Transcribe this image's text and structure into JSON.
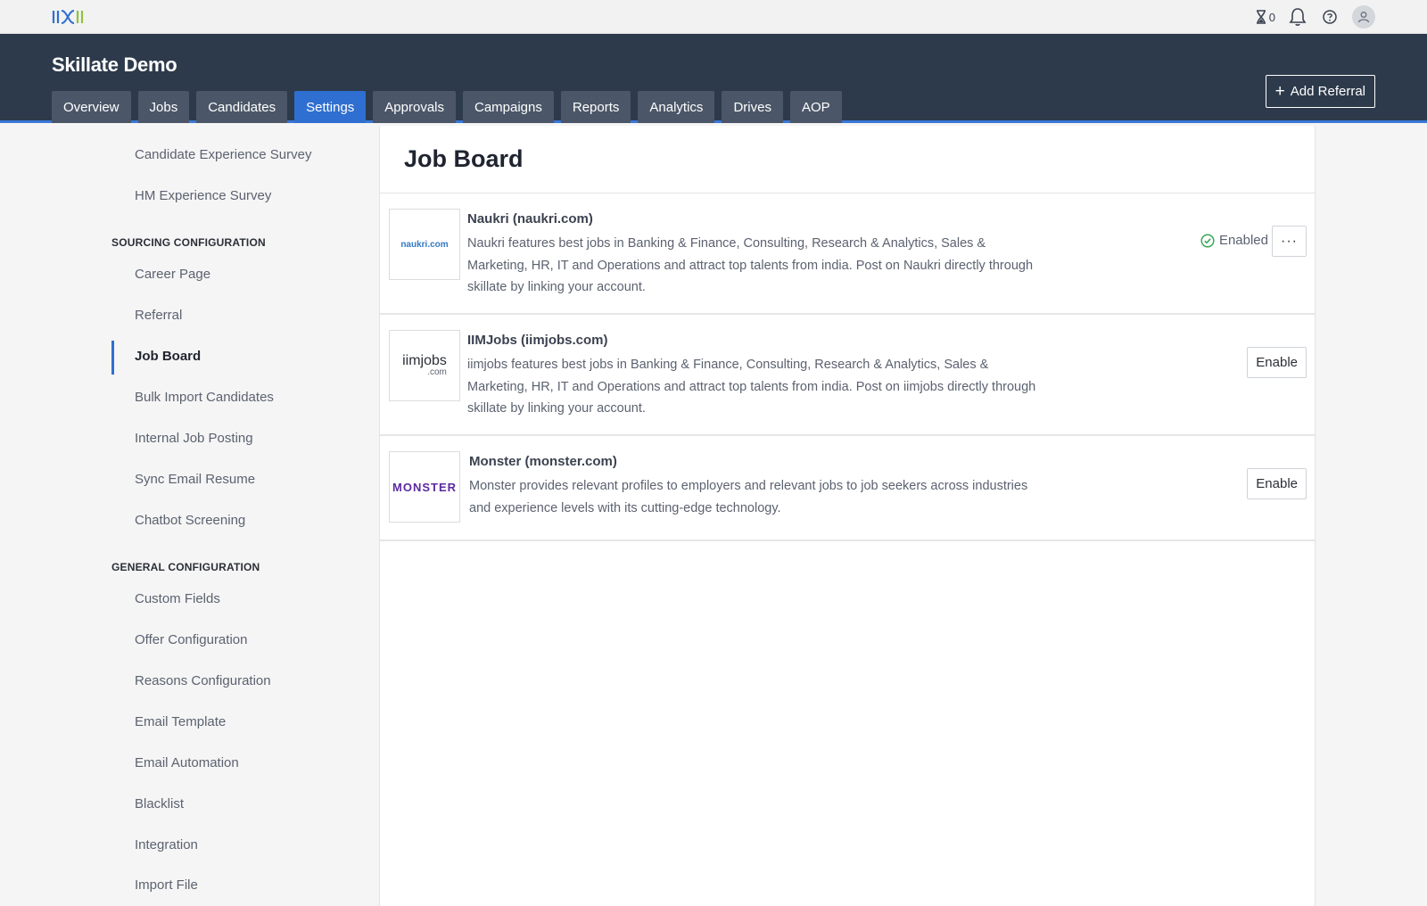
{
  "topbar": {
    "timer_count": "0"
  },
  "header": {
    "org_title": "Skillate Demo",
    "tabs": [
      {
        "label": "Overview"
      },
      {
        "label": "Jobs"
      },
      {
        "label": "Candidates"
      },
      {
        "label": "Settings"
      },
      {
        "label": "Approvals"
      },
      {
        "label": "Campaigns"
      },
      {
        "label": "Reports"
      },
      {
        "label": "Analytics"
      },
      {
        "label": "Drives"
      },
      {
        "label": "AOP"
      }
    ],
    "active_tab": "Settings",
    "add_referral_label": "Add Referral"
  },
  "sidebar": {
    "top_items": [
      {
        "label": "Candidate Experience Survey"
      },
      {
        "label": "HM Experience Survey"
      }
    ],
    "sourcing_section": "SOURCING CONFIGURATION",
    "sourcing_items": [
      {
        "label": "Career Page"
      },
      {
        "label": "Referral"
      },
      {
        "label": "Job Board"
      },
      {
        "label": "Bulk Import Candidates"
      },
      {
        "label": "Internal Job Posting"
      },
      {
        "label": "Sync Email Resume"
      },
      {
        "label": "Chatbot Screening"
      }
    ],
    "general_section": "GENERAL CONFIGURATION",
    "general_items": [
      {
        "label": "Custom Fields"
      },
      {
        "label": "Offer Configuration"
      },
      {
        "label": "Reasons Configuration"
      },
      {
        "label": "Email Template"
      },
      {
        "label": "Email Automation"
      },
      {
        "label": "Blacklist"
      },
      {
        "label": "Integration"
      },
      {
        "label": "Import File"
      }
    ],
    "active_item": "Job Board"
  },
  "main": {
    "title": "Job Board",
    "boards": [
      {
        "name": "Naukri (naukri.com)",
        "logo_text": "naukri.com",
        "description": "Naukri features best jobs in Banking & Finance, Consulting, Research & Analytics, Sales & Marketing, HR, IT and Operations and attract top talents from india. Post on Naukri directly through skillate by linking your account.",
        "status": "Enabled",
        "more_label": "···"
      },
      {
        "name": "IIMJobs (iimjobs.com)",
        "logo_text_main": "iimjobs",
        "logo_text_sub": ".com",
        "description": "iimjobs features best jobs in Banking & Finance, Consulting, Research & Analytics, Sales & Marketing, HR, IT and Operations and attract top talents from india. Post on iimjobs directly through skillate by linking your account.",
        "action_label": "Enable"
      },
      {
        "name": "Monster (monster.com)",
        "logo_text": "MONSTER",
        "description": "Monster provides relevant profiles to employers and relevant jobs to job seekers across industries and experience levels with its cutting-edge technology.",
        "action_label": "Enable"
      }
    ]
  },
  "colors": {
    "header_bg": "#2d3a4b",
    "tab_bg": "#4b5768",
    "accent": "#2f6fd1",
    "success": "#3aa85a",
    "monster_purple": "#5b2aa0"
  }
}
